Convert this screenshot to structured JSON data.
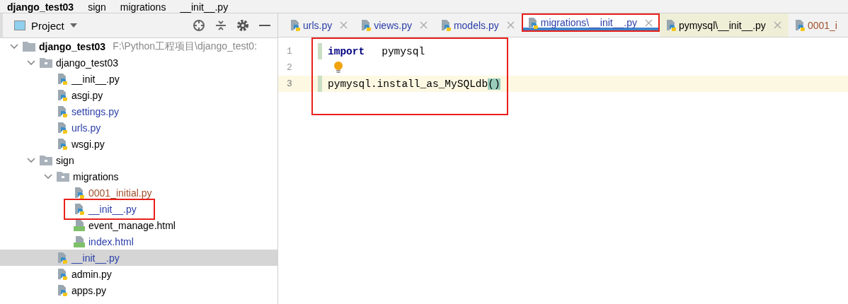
{
  "breadcrumb": [
    "django_test03",
    "sign",
    "migrations",
    "__init__.py"
  ],
  "project_panel": {
    "title": "Project",
    "tree": [
      {
        "name": "django_test03",
        "kind": "root",
        "path": "F:\\Python工程项目\\django_test0:",
        "expanded": true,
        "selected": false,
        "children": [
          {
            "name": "django_test03",
            "kind": "folder",
            "expanded": true,
            "selected": false,
            "children": [
              {
                "name": "__init__.py",
                "kind": "python",
                "color": "#000000",
                "selected": false,
                "highlighted": false
              },
              {
                "name": "asgi.py",
                "kind": "python",
                "color": "#000000",
                "selected": false,
                "highlighted": false
              },
              {
                "name": "settings.py",
                "kind": "python",
                "color": "#2a3ea8",
                "selected": false,
                "highlighted": false
              },
              {
                "name": "urls.py",
                "kind": "python",
                "color": "#2a3ea8",
                "selected": false,
                "highlighted": false
              },
              {
                "name": "wsgi.py",
                "kind": "python",
                "color": "#000000",
                "selected": false,
                "highlighted": false
              }
            ]
          },
          {
            "name": "sign",
            "kind": "folder",
            "expanded": true,
            "selected": false,
            "children": [
              {
                "name": "migrations",
                "kind": "folder",
                "expanded": true,
                "selected": false,
                "children": [
                  {
                    "name": "0001_initial.py",
                    "kind": "python",
                    "color": "#a0522d",
                    "selected": false,
                    "highlighted": false
                  },
                  {
                    "name": "__init__.py",
                    "kind": "python",
                    "color": "#2a3ea8",
                    "selected": false,
                    "highlighted": true
                  },
                  {
                    "name": "event_manage.html",
                    "kind": "html",
                    "color": "#000000",
                    "selected": false,
                    "highlighted": false
                  },
                  {
                    "name": "index.html",
                    "kind": "html",
                    "color": "#2a3ea8",
                    "selected": false,
                    "highlighted": false
                  }
                ]
              },
              {
                "name": "__init__.py",
                "kind": "python",
                "color": "#2a3ea8",
                "selected": true,
                "highlighted": false
              },
              {
                "name": "admin.py",
                "kind": "python",
                "color": "#000000",
                "selected": false,
                "highlighted": false
              },
              {
                "name": "apps.py",
                "kind": "python",
                "color": "#000000",
                "selected": false,
                "highlighted": false
              }
            ]
          }
        ]
      }
    ]
  },
  "tabs": [
    {
      "label": "urls.py",
      "color": "#2a3ea8",
      "selected": false,
      "kind": "project",
      "closable": true,
      "highlighted": false
    },
    {
      "label": "views.py",
      "color": "#2a3ea8",
      "selected": false,
      "kind": "project",
      "closable": true,
      "highlighted": false
    },
    {
      "label": "models.py",
      "color": "#2a3ea8",
      "selected": false,
      "kind": "project",
      "closable": true,
      "highlighted": false
    },
    {
      "label": "migrations\\__init__.py",
      "color": "#2a3ea8",
      "selected": true,
      "kind": "project",
      "closable": true,
      "highlighted": true
    },
    {
      "label": "pymysql\\__init__.py",
      "color": "#000000",
      "selected": false,
      "kind": "library",
      "closable": true,
      "highlighted": false
    },
    {
      "label": "0001_i",
      "color": "#a0522d",
      "selected": false,
      "kind": "project",
      "closable": false,
      "highlighted": false
    }
  ],
  "editor": {
    "highlighted": true,
    "lines": [
      {
        "number": "1",
        "current": false,
        "changed": true,
        "bulb": false,
        "tokens": [
          {
            "text": "import",
            "kind": "keyword"
          },
          {
            "text": "pymysql",
            "kind": "plain"
          }
        ]
      },
      {
        "number": "2",
        "current": false,
        "changed": false,
        "bulb": true
      },
      {
        "number": "3",
        "current": true,
        "changed": true,
        "bulb": false,
        "tokens": [
          {
            "text": "pymysql.install_as_MySQLdb",
            "kind": "plain"
          },
          {
            "text": "()",
            "kind": "brace-match"
          }
        ]
      }
    ]
  }
}
